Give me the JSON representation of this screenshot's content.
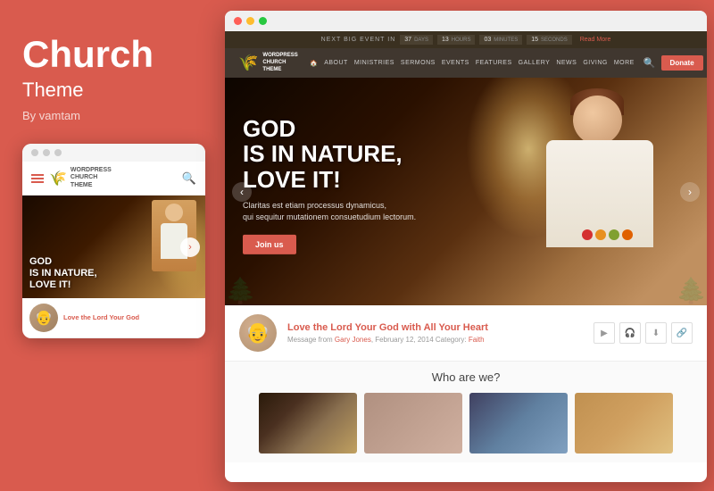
{
  "left_panel": {
    "title": "Church",
    "subtitle": "Theme",
    "by_line": "By vamtam"
  },
  "mobile": {
    "window_dots": [
      "dot1",
      "dot2",
      "dot3"
    ],
    "nav": {
      "logo_lines": [
        "WORDPRESS",
        "CHURCH",
        "THEME"
      ],
      "search_icon": "🔍"
    },
    "hero": {
      "text_line1": "GOD",
      "text_line2": "IS IN NATURE,",
      "text_line3": "LOVE IT!"
    },
    "sermon": {
      "title": "Love the Lord Your God"
    }
  },
  "desktop": {
    "window_dots": [
      "red",
      "yellow",
      "green"
    ],
    "top_bar": {
      "event_label": "NEXT BIG EVENT IN",
      "days_count": "37",
      "days_label": "DAYS",
      "hours_count": "13",
      "hours_label": "HOURS",
      "minutes_count": "03",
      "minutes_label": "MINUTES",
      "seconds_count": "15",
      "seconds_label": "SECONDS",
      "read_more": "Read More"
    },
    "nav": {
      "logo_lines": [
        "WORDPRESS",
        "CHURCH",
        "THEME"
      ],
      "links": [
        "ABOUT",
        "MINISTRIES",
        "SERMONS",
        "EVENTS",
        "FEATURES",
        "GALLERY",
        "NEWS",
        "GIVING",
        "MORE"
      ],
      "donate_label": "Donate"
    },
    "hero": {
      "title_line1": "GOD",
      "title_line2": "IS IN NATURE,",
      "title_line3": "LOVE IT!",
      "subtitle": "Claritas est etiam processus dynamicus,\nqui sequitur mutationem consuetudium lectorum.",
      "btn_label": "Join us",
      "prev_arrow": "‹",
      "next_arrow": "›"
    },
    "sermon": {
      "title": "Love the Lord Your God with All Your Heart",
      "meta_prefix": "Message from",
      "author": "Gary Jones",
      "date": "February 12, 2014",
      "category_label": "Category:",
      "category": "Faith",
      "icon_play": "▶",
      "icon_headphone": "🎧",
      "icon_download": "⬇",
      "icon_share": "🔗"
    },
    "who_section": {
      "title": "Who are we?"
    }
  }
}
